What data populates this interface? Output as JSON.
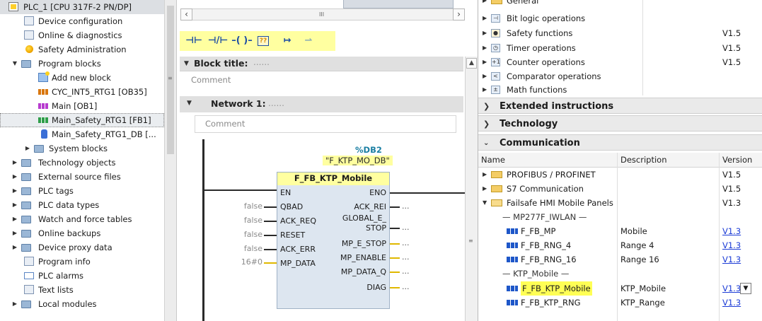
{
  "tree": {
    "items": [
      {
        "label": "PLC_1 [CPU 317F-2 PN/DP]",
        "icon": "plc-icon"
      },
      {
        "label": "Device configuration",
        "icon": "device-config-icon"
      },
      {
        "label": "Online & diagnostics",
        "icon": "online-diagnostics-icon"
      },
      {
        "label": "Safety Administration",
        "icon": "safety-icon"
      },
      {
        "label": "Program blocks",
        "icon": "folder-icon"
      },
      {
        "label": "Add new block",
        "icon": "add-block-icon"
      },
      {
        "label": "CYC_INT5_RTG1 [OB35]",
        "icon": "ob-icon"
      },
      {
        "label": "Main [OB1]",
        "icon": "ob-icon"
      },
      {
        "label": "Main_Safety_RTG1 [FB1]",
        "icon": "fb-icon"
      },
      {
        "label": "Main_Safety_RTG1_DB [...",
        "icon": "db-icon"
      },
      {
        "label": "System blocks",
        "icon": "folder-icon"
      },
      {
        "label": "Technology objects",
        "icon": "folder-icon"
      },
      {
        "label": "External source files",
        "icon": "folder-icon"
      },
      {
        "label": "PLC tags",
        "icon": "folder-icon"
      },
      {
        "label": "PLC data types",
        "icon": "folder-icon"
      },
      {
        "label": "Watch and force tables",
        "icon": "folder-icon"
      },
      {
        "label": "Online backups",
        "icon": "folder-icon"
      },
      {
        "label": "Device proxy data",
        "icon": "folder-icon"
      },
      {
        "label": "Program info",
        "icon": "program-info-icon"
      },
      {
        "label": "PLC alarms",
        "icon": "alarm-icon"
      },
      {
        "label": "Text lists",
        "icon": "text-list-icon"
      },
      {
        "label": "Local modules",
        "icon": "folder-icon"
      }
    ]
  },
  "editor": {
    "scroll_grip": "III",
    "toolbar": {
      "no_contact": "⊣⊢",
      "nc_contact": "⊣/⊢",
      "coil": "–( )–",
      "empty_box": "??",
      "open_branch": "↦",
      "close_branch": "⇀"
    },
    "block_title_label": "Block title:",
    "block_title_dots": "......",
    "block_comment": "Comment",
    "network_label": "Network 1:",
    "network_dots": "......",
    "network_comment": "Comment",
    "db_name": "%DB2",
    "db_instance": "\"F_KTP_MO_DB\"",
    "fb_name": "F_FB_KTP_Mobile",
    "inputs": {
      "en": "EN",
      "qbad": "QBAD",
      "ack_req": "ACK_REQ",
      "reset": "RESET",
      "ack_err": "ACK_ERR",
      "mp_data": "MP_DATA"
    },
    "input_values": {
      "qbad": "false",
      "ack_req": "false",
      "reset": "false",
      "ack_err": "false",
      "mp_data": "16#0"
    },
    "outputs": {
      "eno": "ENO",
      "ack_rei": "ACK_REI",
      "global_e_1": "GLOBAL_E_",
      "global_e_2": "STOP",
      "mp_e_stop": "MP_E_STOP",
      "mp_enable": "MP_ENABLE",
      "mp_data_q": "MP_DATA_Q",
      "diag": "DIAG"
    },
    "out_placeholder": "..."
  },
  "instructions": {
    "basic": [
      {
        "label": "General",
        "version": ""
      },
      {
        "label": "Bit logic operations",
        "version": ""
      },
      {
        "label": "Safety functions",
        "version": "V1.5"
      },
      {
        "label": "Timer operations",
        "version": "V1.5"
      },
      {
        "label": "Counter operations",
        "version": "V1.5"
      },
      {
        "label": "Comparator operations",
        "version": ""
      },
      {
        "label": "Math functions",
        "version": ""
      }
    ],
    "sections": {
      "extended": "Extended instructions",
      "technology": "Technology",
      "communication": "Communication"
    },
    "columns": {
      "name": "Name",
      "description": "Description",
      "version": "Version"
    },
    "comm_rows": [
      {
        "label": "PROFIBUS / PROFINET",
        "description": "",
        "version": "V1.5"
      },
      {
        "label": "S7 Communication",
        "description": "",
        "version": "V1.5"
      },
      {
        "label": "Failsafe HMI Mobile Panels",
        "description": "",
        "version": "V1.3"
      }
    ],
    "group_mp277": "— MP277F_IWLAN —",
    "mp277_rows": [
      {
        "label": "F_FB_MP",
        "description": "Mobile",
        "version": "V1.3"
      },
      {
        "label": "F_FB_RNG_4",
        "description": "Range 4",
        "version": "V1.3"
      },
      {
        "label": "F_FB_RNG_16",
        "description": "Range 16",
        "version": "V1.3"
      }
    ],
    "group_ktp": "— KTP_Mobile —",
    "ktp_rows": [
      {
        "label": "F_FB_KTP_Mobile",
        "description": "KTP_Mobile",
        "version": "V1.3"
      },
      {
        "label": "F_FB_KTP_RNG",
        "description": "KTP_Range",
        "version": "V1.3"
      }
    ]
  },
  "colors": {
    "highlight_yellow": "#ffff55",
    "toolbar_yellow": "#ffffa0",
    "link_blue": "#1b3bd6",
    "db_name_teal": "#1b7fa3",
    "section_gray": "#eaeaea"
  }
}
